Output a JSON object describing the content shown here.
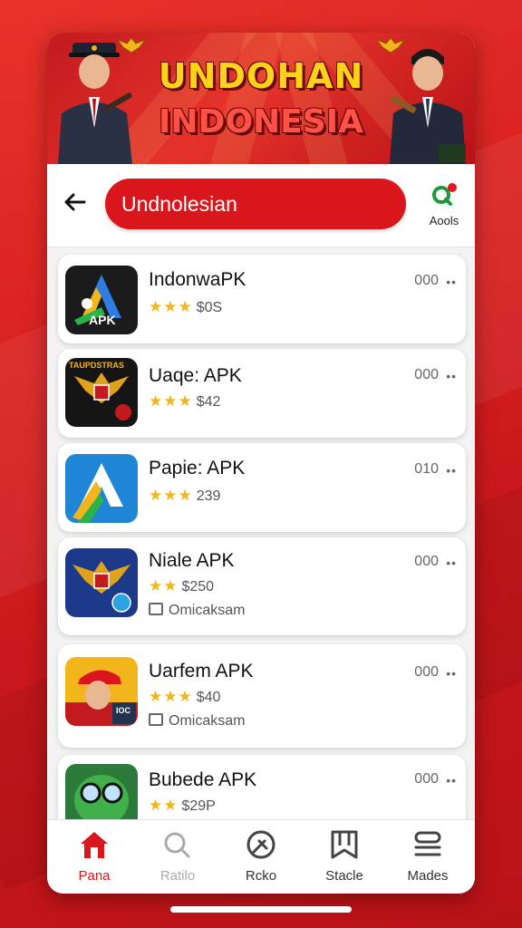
{
  "banner": {
    "title_line1": "UNDOHAN",
    "title_line2": "INDONESIA"
  },
  "header": {
    "back_icon": "arrow-left-icon",
    "search_value": "Undnolesian",
    "apps_label": "Aools"
  },
  "apps": [
    {
      "name": "IndonwaPK",
      "rating": "$0S",
      "stars": 3,
      "count": "000",
      "icon_text": "APK"
    },
    {
      "name": "Uaqe: APK",
      "rating": "$42",
      "stars": 3,
      "count": "000",
      "icon_text": "TAUPDSTRAS"
    },
    {
      "name": "Papie: APK",
      "rating": "239",
      "stars": 3,
      "count": "010"
    },
    {
      "name": "Niale APK",
      "rating": "$250",
      "stars": 2,
      "count": "000",
      "subtitle": "Omicaksam"
    },
    {
      "name": "Uarfem APK",
      "rating": "$40",
      "stars": 3,
      "count": "000",
      "subtitle": "Omicaksam",
      "icon_text": "IOC"
    },
    {
      "name": "Bubede APK",
      "rating": "$29P",
      "stars": 2,
      "count": "000"
    }
  ],
  "more_glyph": "••",
  "nav": [
    {
      "label": "Pana",
      "icon": "home-icon",
      "active": true
    },
    {
      "label": "Ratilo",
      "icon": "search-icon",
      "muted": true
    },
    {
      "label": "Rcko",
      "icon": "compass-icon"
    },
    {
      "label": "Stacle",
      "icon": "bookmark-icon"
    },
    {
      "label": "Mades",
      "icon": "stack-icon"
    }
  ],
  "colors": {
    "brand_red": "#d8161b",
    "star": "#f2b51c",
    "banner_yellow": "#ffd21a"
  }
}
